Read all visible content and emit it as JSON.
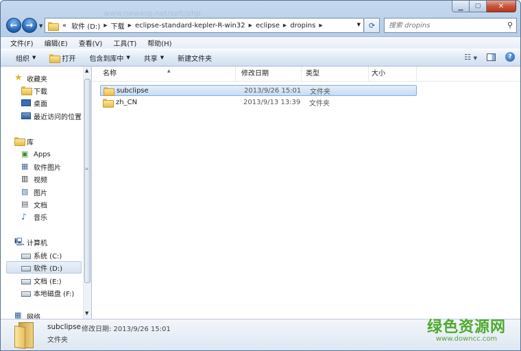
{
  "window": {
    "url_ghost": "www.newasp.net/soft/php"
  },
  "nav": {
    "back_glyph": "←",
    "forward_glyph": "→",
    "breadcrumb": [
      "«",
      "软件 (D:)",
      "下载",
      "eclipse-standard-kepler-R-win32",
      "eclipse",
      "dropins"
    ],
    "search_placeholder": "搜索 dropins"
  },
  "menu": [
    "文件(F)",
    "编辑(E)",
    "查看(V)",
    "工具(T)",
    "帮助(H)"
  ],
  "toolbar": {
    "organize": "组织",
    "open": "打开",
    "include_library": "包含到库中",
    "share": "共享",
    "new_folder": "新建文件夹"
  },
  "sidebar": {
    "favorites": "收藏夹",
    "favorites_items": [
      "下载",
      "桌面",
      "最近访问的位置"
    ],
    "libraries": "库",
    "libraries_items": [
      "Apps",
      "软件图片",
      "视频",
      "图片",
      "文档",
      "音乐"
    ],
    "computer": "计算机",
    "computer_items": [
      "系统 (C:)",
      "软件 (D:)",
      "文档 (E:)",
      "本地磁盘 (F:)"
    ],
    "network": "网络"
  },
  "columns": [
    "名称",
    "修改日期",
    "类型",
    "大小"
  ],
  "files": [
    {
      "name": "subclipse",
      "date": "2013/9/26 15:01",
      "type": "文件夹",
      "selected": true
    },
    {
      "name": "zh_CN",
      "date": "2013/9/13 13:39",
      "type": "文件夹",
      "selected": false
    }
  ],
  "details": {
    "name": "subclipse",
    "prop_label": "修改日期: 2013/9/26 15:01",
    "type": "文件夹"
  },
  "watermark": {
    "cn": "绿色资源网",
    "en": "www.downcc.com",
    "color": "#4caa2c"
  },
  "icons": {
    "favorites": "star-icon",
    "libraries": "library-icon",
    "computer": "computer-icon",
    "drive": "drive-icon",
    "folder": "folder-icon"
  }
}
